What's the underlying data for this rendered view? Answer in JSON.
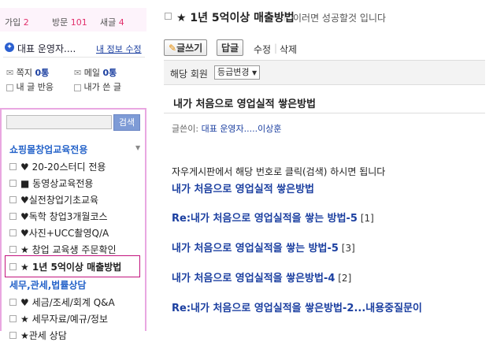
{
  "sidebar": {
    "stats": [
      {
        "label": "가입",
        "value": "2"
      },
      {
        "label": "방문",
        "value": "101"
      },
      {
        "label": "새글",
        "value": "4"
      }
    ],
    "profile": {
      "name": "대표 운영자....",
      "edit_link": "내 정보 수정",
      "note_label": "쪽지",
      "note_value": "0통",
      "mail_label": "메일",
      "mail_value": "0통",
      "my_comments": "내 글 반응",
      "my_posts": "내가 쓴 글"
    },
    "search": {
      "button": "검색",
      "placeholder": ""
    },
    "categories": [
      {
        "title": "쇼핑몰창업교육전용",
        "items": [
          {
            "label": "♥ 20-20스터디 전용"
          },
          {
            "label": "■ 동영상교육전용"
          },
          {
            "label": "♥실전창업기초교육"
          },
          {
            "label": "♥독학 창업3개월코스"
          },
          {
            "label": "♥사진+UCC촬영Q/A"
          },
          {
            "label": "★ 창업 교육생 주문확인"
          },
          {
            "label": "★ 1년 5억이상 매출방법"
          }
        ]
      },
      {
        "title": "세무,관세,법률상담",
        "items": [
          {
            "label": "♥ 세금/조세/회계 Q&A"
          },
          {
            "label": "★ 세무자료/예규/정보"
          },
          {
            "label": "★관세 상담"
          }
        ]
      }
    ]
  },
  "main": {
    "board_title": "★ 1년 5억이상 매출방법",
    "board_subtitle": "이러면 성공할것 입니다",
    "toolbar": {
      "write": "글쓰기",
      "reply": "답글",
      "edit": "수정",
      "delete": "삭제"
    },
    "member_label": "해당 회원",
    "grade_change": "등급변경",
    "post_title": "내가 처음으로 영업실적 쌓은방법",
    "author_label": "글쓴이:",
    "author_name": "대표 운영자.....이상훈",
    "body_text": "자우게시판에서 해당 번호로 클릭(검색) 하시면 됩니다",
    "links": [
      {
        "text": "내가 처음으로 영업실적 쌓은방법",
        "count": ""
      },
      {
        "text": "Re:내가 처음으로 영업실적을 쌓는 방법-5",
        "count": "[1]"
      },
      {
        "text": "내가 처음으로 영업실적을 쌓는 방법-5",
        "count": "[3]"
      },
      {
        "text": "내가 처음으로 영업실적을 쌓은방법-4",
        "count": "[2]"
      },
      {
        "text": "Re:내가 처음으로 영업실적을 쌓은방법-2...내용중질문이",
        "count": ""
      }
    ]
  }
}
